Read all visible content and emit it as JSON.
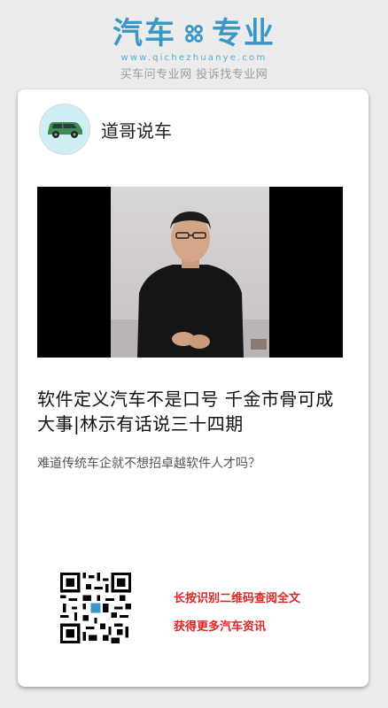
{
  "brand": {
    "name_left": "汽车",
    "name_right": "专业",
    "url": "www.qichezhuanye.com",
    "slogan": "买车问专业网 投诉找专业网"
  },
  "author": {
    "name": "道哥说车",
    "avatar_icon": "car-icon"
  },
  "video": {
    "icon": "person-presenter"
  },
  "article": {
    "title": "软件定义汽车不是口号  千金市骨可成大事|林示有话说三十四期",
    "subtitle": "难道传统车企就不想招卓越软件人才吗？"
  },
  "promo": {
    "line1": "长按识别二维码查阅全文",
    "line2": "获得更多汽车资讯"
  },
  "colors": {
    "brand": "#3a98c8",
    "promo": "#e02424",
    "background": "#ececec"
  }
}
